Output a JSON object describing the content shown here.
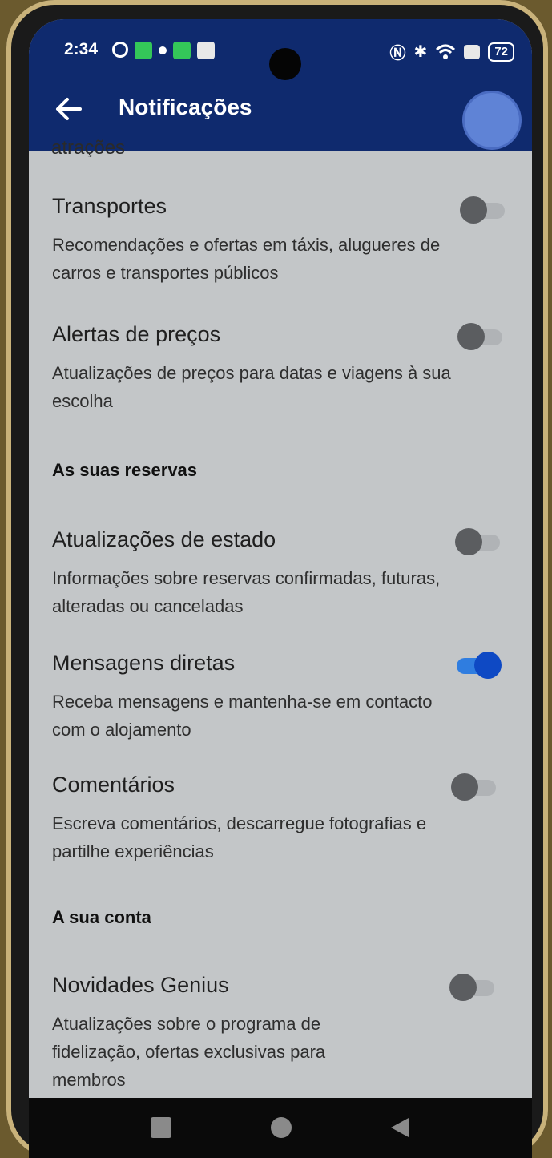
{
  "status_bar": {
    "time": "2:34",
    "battery": "72",
    "icons_left": [
      "settings-icon",
      "grid-app-icon",
      "dot-icon",
      "green-app-icon",
      "message-icon"
    ],
    "icons_right": [
      "nfc-icon",
      "bluetooth-icon",
      "wifi-icon",
      "battery-icon"
    ]
  },
  "app_bar": {
    "title": "Notificações",
    "background": "#0f2a6e"
  },
  "partial_item_text": "atrações",
  "settings": [
    {
      "title": "Transportes",
      "description": "Recomendações e ofertas em táxis, alugueres de carros e transportes públicos",
      "enabled": false
    },
    {
      "title": "Alertas de preços",
      "description": "Atualizações de preços para datas e viagens à sua escolha",
      "enabled": false
    }
  ],
  "sections": [
    {
      "header": "As suas reservas",
      "items": [
        {
          "title": "Atualizações de estado",
          "description": "Informações sobre reservas confirmadas, futuras, alteradas ou canceladas",
          "enabled": false
        },
        {
          "title": "Mensagens diretas",
          "description": "Receba mensagens e mantenha-se em contacto com o alojamento",
          "enabled": true
        },
        {
          "title": "Comentários",
          "description": "Escreva comentários, descarregue fotografias e partilhe experiências",
          "enabled": false
        }
      ]
    },
    {
      "header": "A sua conta",
      "items": [
        {
          "title": "Novidades Genius",
          "description": "Atualizações sobre o programa de fidelização, ofertas exclusivas para membros",
          "enabled": false
        }
      ]
    }
  ],
  "colors": {
    "toggle_on": "#0e49c4",
    "toggle_off": "#5b5d60",
    "screen_bg": "#c3c6c8"
  }
}
